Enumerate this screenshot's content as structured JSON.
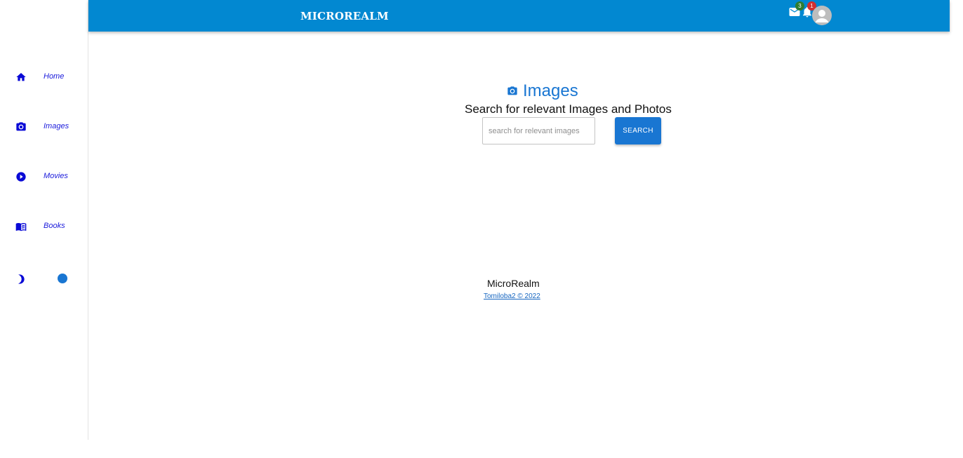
{
  "appbar": {
    "brand": "MICROREALM",
    "mail_badge_count": "3",
    "notification_badge_count": "1",
    "icons": [
      "mail-icon",
      "bell-icon",
      "account-circle-icon"
    ]
  },
  "sidebar": {
    "items": [
      {
        "label": "Home",
        "icon": "home-icon"
      },
      {
        "label": "Images",
        "icon": "camera-icon"
      },
      {
        "label": "Movies",
        "icon": "play-circle-icon"
      },
      {
        "label": "Books",
        "icon": "book-icon"
      }
    ],
    "theme_toggle_icon": "moon-icon"
  },
  "main": {
    "heading": "Images",
    "heading_icon": "camera-icon",
    "subtitle": "Search for relevant Images and Photos",
    "search": {
      "placeholder": "search for relevant images",
      "value": "",
      "button_label": "SEARCH"
    }
  },
  "footer": {
    "name": "MicroRealm",
    "credit": "Tomiloba2 © 2022"
  },
  "colors": {
    "appbar": "#0288d1",
    "primary": "#1976d2",
    "nav_text": "#1a1adb",
    "mail_badge": "#2e7d32",
    "bell_badge": "#d32f2f"
  }
}
